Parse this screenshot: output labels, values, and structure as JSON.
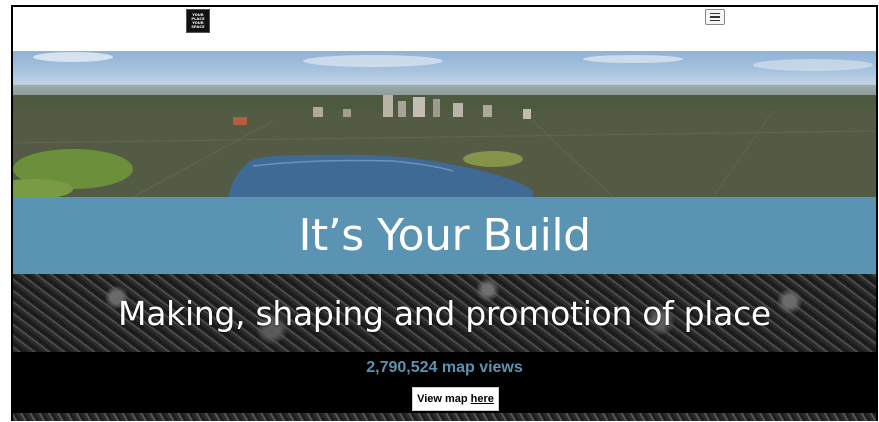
{
  "header": {
    "logo_lines": [
      "YOUR",
      "PLACE",
      "YOUR",
      "SPACE"
    ],
    "menu_icon": "hamburger-menu-icon"
  },
  "hero": {
    "title": "It’s Your Build",
    "subtitle": "Making, shaping and promotion of place"
  },
  "stats": {
    "map_views": "2,790,524 map views",
    "view_map_prefix": "View map",
    "view_map_link": "here"
  },
  "colors": {
    "accent_blue": "#5b93b3",
    "stats_background": "#000000"
  }
}
